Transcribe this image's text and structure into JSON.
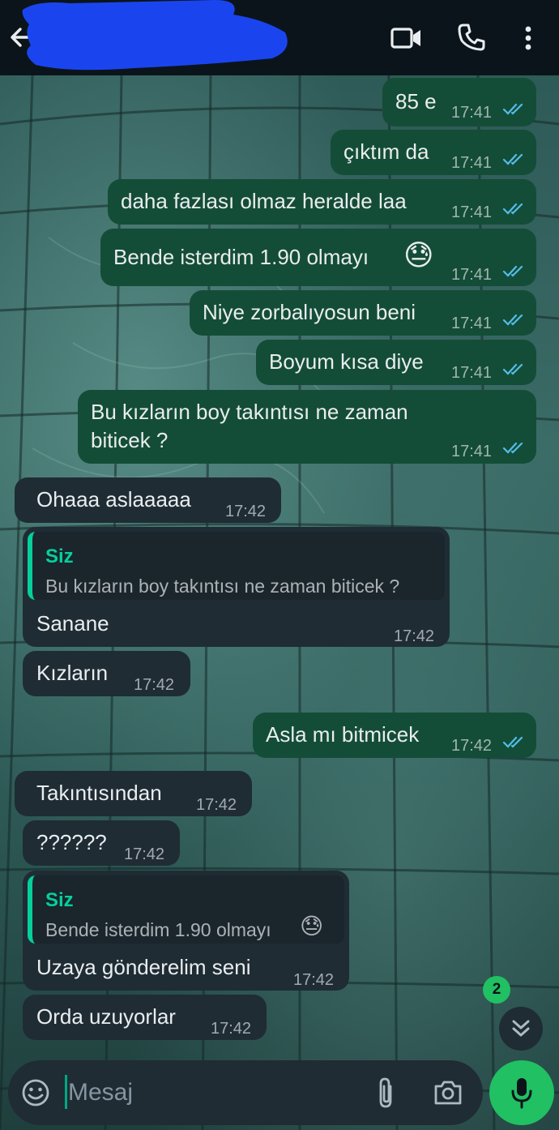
{
  "header": {
    "contact_name": "",
    "back": "back",
    "icons": [
      "arrow-left-icon",
      "video-camera-icon",
      "phone-icon",
      "more-vertical-icon"
    ]
  },
  "messages": [
    {
      "direction": "out",
      "text": "85 e",
      "time": "17:41",
      "status": "read"
    },
    {
      "direction": "out",
      "text": "çıktım da",
      "time": "17:41",
      "status": "read"
    },
    {
      "direction": "out",
      "text": "daha fazlası olmaz heralde laa",
      "time": "17:41",
      "status": "read"
    },
    {
      "direction": "out",
      "text": "Bende isterdim 1.90 olmayı",
      "emoji": "😓",
      "time": "17:41",
      "status": "read"
    },
    {
      "direction": "out",
      "text": "Niye zorbalıyosun beni",
      "time": "17:41",
      "status": "read"
    },
    {
      "direction": "out",
      "text": "Boyum kısa diye",
      "time": "17:41",
      "status": "read"
    },
    {
      "direction": "out",
      "text_line1": "Bu kızların boy takıntısı ne zaman",
      "text_line2": "biticek ?",
      "time": "17:41",
      "status": "read"
    },
    {
      "direction": "in",
      "text": "Ohaaa aslaaaaa",
      "time": "17:42"
    },
    {
      "direction": "in",
      "reply_to": {
        "author": "Siz",
        "text": "Bu kızların boy takıntısı ne zaman biticek ?"
      },
      "text": "Sanane",
      "time": "17:42"
    },
    {
      "direction": "in",
      "text": "Kızların",
      "time": "17:42"
    },
    {
      "direction": "out",
      "text": "Asla mı bitmicek",
      "time": "17:42",
      "status": "read"
    },
    {
      "direction": "in",
      "text": "Takıntısından",
      "time": "17:42"
    },
    {
      "direction": "in",
      "text": "??????",
      "time": "17:42"
    },
    {
      "direction": "in",
      "reply_to": {
        "author": "Siz",
        "text": "Bende isterdim 1.90 olmayı",
        "emoji": "😓"
      },
      "text": "Uzaya gönderelim seni",
      "time": "17:42"
    },
    {
      "direction": "in",
      "text": "Orda uzuyorlar",
      "time": "17:42"
    }
  ],
  "scroll_down": {
    "unread_count": "2"
  },
  "composer": {
    "placeholder": "Mesaj",
    "value": ""
  },
  "colors": {
    "outgoing_bubble": "#144d37",
    "incoming_bubble": "#1f2c34",
    "accent": "#21c063",
    "read_ticks": "#53bdeb",
    "reply_author": "#06cf9c"
  }
}
